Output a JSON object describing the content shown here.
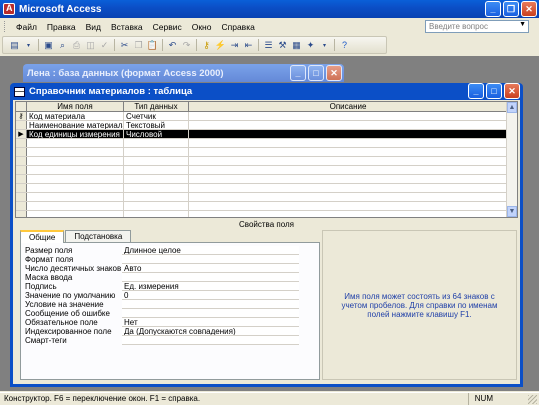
{
  "app": {
    "title": "Microsoft Access"
  },
  "menu": {
    "items": [
      "Файл",
      "Правка",
      "Вид",
      "Вставка",
      "Сервис",
      "Окно",
      "Справка"
    ],
    "help_placeholder": "Введите вопрос"
  },
  "toolbar": {
    "icons": [
      "view-icon",
      "save-icon",
      "search-icon",
      "print-icon",
      "print-preview-icon",
      "spellcheck-icon",
      "cut-icon",
      "copy-icon",
      "paste-icon",
      "undo-icon",
      "redo-icon",
      "primary-key-icon",
      "indexes-icon",
      "insert-rows-icon",
      "delete-rows-icon",
      "properties-icon",
      "build-icon",
      "database-window-icon",
      "new-object-icon",
      "help-icon"
    ]
  },
  "db_window": {
    "title": "Лена : база данных (формат Access 2000)"
  },
  "table_window": {
    "title": "Справочник материалов : таблица",
    "columns": [
      "Имя поля",
      "Тип данных",
      "Описание"
    ],
    "rows": [
      {
        "name": "Код материала",
        "type": "Счетчик",
        "description": "",
        "marker": "key"
      },
      {
        "name": "Наименование материала",
        "type": "Текстовый",
        "description": "",
        "marker": ""
      },
      {
        "name": "Код единицы измерения",
        "type": "Числовой",
        "description": "",
        "marker": "current"
      }
    ],
    "empty_rows": 9
  },
  "properties": {
    "title": "Свойства поля",
    "tabs": [
      "Общие",
      "Подстановка"
    ],
    "active_tab": "Общие",
    "rows": [
      {
        "label": "Размер поля",
        "value": "Длинное целое"
      },
      {
        "label": "Формат поля",
        "value": ""
      },
      {
        "label": "Число десятичных знаков",
        "value": "Авто"
      },
      {
        "label": "Маска ввода",
        "value": ""
      },
      {
        "label": "Подпись",
        "value": "Ед. измерения"
      },
      {
        "label": "Значение по умолчанию",
        "value": "0"
      },
      {
        "label": "Условие на значение",
        "value": ""
      },
      {
        "label": "Сообщение об ошибке",
        "value": ""
      },
      {
        "label": "Обязательное поле",
        "value": "Нет"
      },
      {
        "label": "Индексированное поле",
        "value": "Да (Допускаются совпадения)"
      },
      {
        "label": "Смарт-теги",
        "value": ""
      }
    ],
    "hint": "Имя поля может состоять из 64 знаков с учетом пробелов.  Для справки по именам полей нажмите клавишу F1."
  },
  "status": {
    "text": "Конструктор.  F6 = переключение окон.  F1 = справка.",
    "num": "NUM"
  }
}
